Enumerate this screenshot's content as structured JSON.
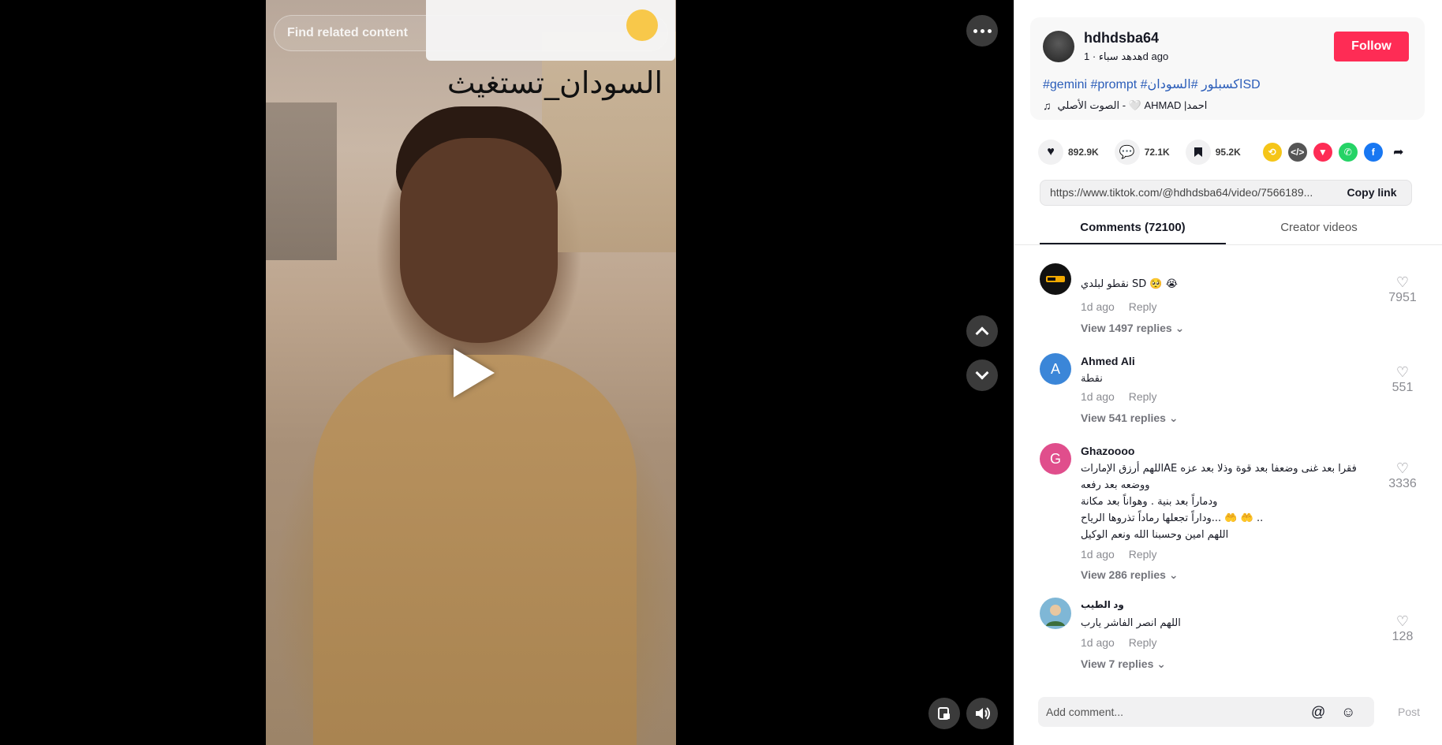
{
  "video": {
    "search_placeholder": "Find related content",
    "caption": "السودان_تستغيث"
  },
  "author": {
    "username": "hdhdsba64",
    "nickname": "هدهد سباء",
    "posted": "1d ago"
  },
  "follow_label": "Follow",
  "description": {
    "tags": "#gemini #prompt #اكسبلور #السودانSD"
  },
  "music": "الصوت الأصلي - 🤍 AHMAD |احمد",
  "actions": {
    "likes": "892.9K",
    "comments": "72.1K",
    "saves": "95.2K"
  },
  "share": {
    "url": "https://www.tiktok.com/@hdhdsba64/video/7566189...",
    "copy_label": "Copy link"
  },
  "tabs": [
    {
      "label": "Comments (72100)"
    },
    {
      "label": "Creator videos"
    }
  ],
  "comments": [
    {
      "name": "",
      "text": "نقطو لبلدي SD 🥺 😭",
      "time": "1d ago",
      "reply": "Reply",
      "view_replies": "View 1497 replies",
      "likes": "7951",
      "avatar_letter": "",
      "avatar_color": "#111111"
    },
    {
      "name": "Ahmed Ali",
      "text": "نقطة",
      "time": "1d ago",
      "reply": "Reply",
      "view_replies": "View 541 replies",
      "likes": "551",
      "avatar_letter": "A",
      "avatar_color": "#3b86d8"
    },
    {
      "name": "Ghazoooo",
      "text_lines": [
        "اللهم أرزق الإماراتAE فقرا بعد غنى وضعفا بعد قوة وذلا بعد عزه",
        "ووضعه بعد رفعه",
        "ودماراً بعد بنية . وهواناً بعد مكانة",
        "وداراً تجعلها رماداً تذروها الرياح... 🤲 🤲 ..",
        "اللهم امين وحسبنا الله ونعم الوكيل"
      ],
      "time": "1d ago",
      "reply": "Reply",
      "view_replies": "View 286 replies",
      "likes": "3336",
      "avatar_letter": "G",
      "avatar_color": "#e04e8c"
    },
    {
      "name": "ود الطيب",
      "text": "اللهم انصر الفاشر يارب",
      "time": "1d ago",
      "reply": "Reply",
      "view_replies": "View 7 replies",
      "likes": "128",
      "avatar_letter": "",
      "avatar_color": "#7fb7d6"
    }
  ],
  "comment_input": {
    "placeholder": "Add comment...",
    "post_label": "Post"
  },
  "colors": {
    "accent": "#fe2c55",
    "hashtag": "#2b5db9"
  }
}
